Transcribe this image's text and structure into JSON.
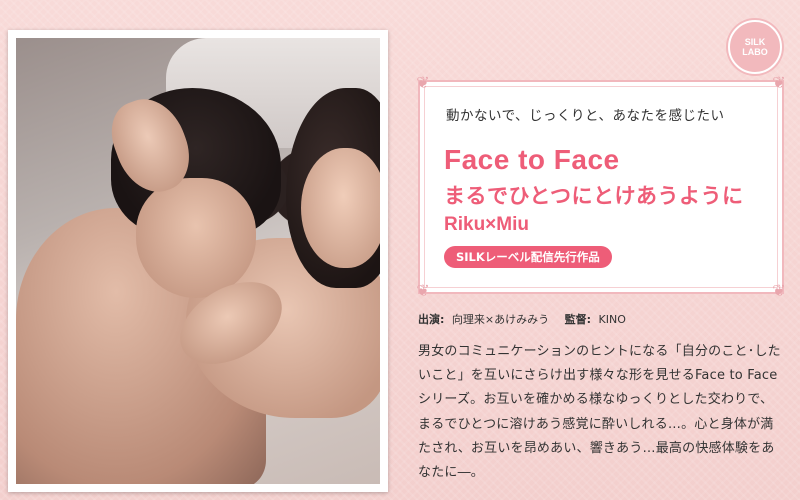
{
  "logo": {
    "line1": "SILK",
    "line2": "LABO"
  },
  "card": {
    "tagline": "動かないで、じっくりと、あなたを感じたい",
    "title_en": "Face to Face",
    "title_jp": "まるでひとつにとけあうように",
    "cast": "Riku×Miu",
    "badge": "SILKレーベル配信先行作品"
  },
  "credits": {
    "cast_label": "出演:",
    "cast_value": "向理来×あけみみう",
    "director_label": "監督:",
    "director_value": "KINO"
  },
  "description": "男女のコミュニケーションのヒントになる「自分のこと･したいこと」を互いにさらけ出す様々な形を見せるFace to Faceシリーズ。お互いを確かめる様なゆっくりとした交わりで、まるでひとつに溶けあう感覚に酔いしれる…。心と身体が満たされ、お互いを昂めあい、響きあう…最高の快感体験をあなたに―。",
  "colors": {
    "accent": "#ee5d78",
    "background": "#f6d5d3",
    "frame": "#f1b8bd"
  }
}
